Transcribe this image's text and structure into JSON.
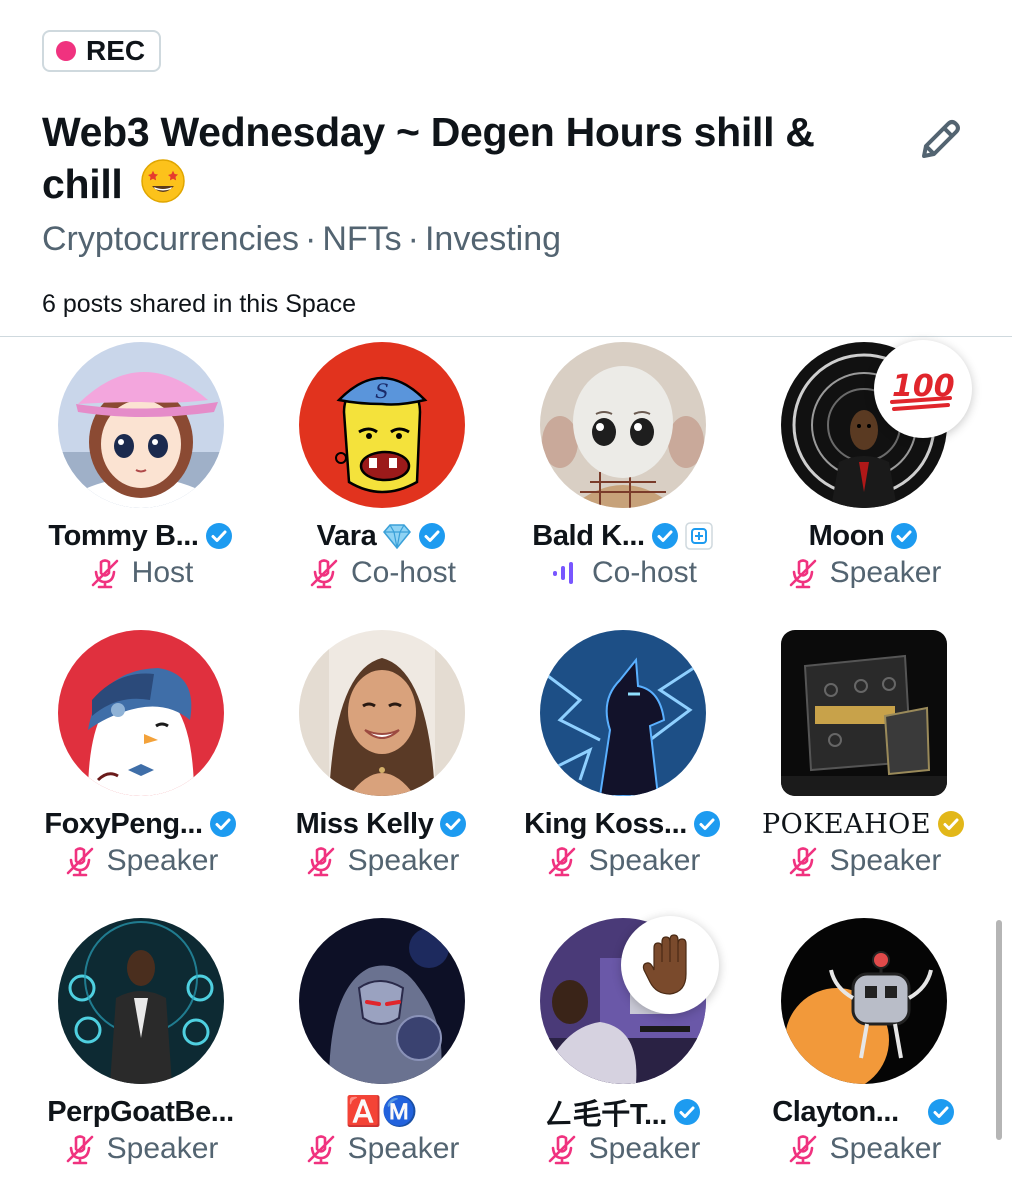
{
  "rec_badge": {
    "label": "REC",
    "color": "#f0327f"
  },
  "space": {
    "title": "Web3 Wednesday ~ Degen Hours shill & chill",
    "title_emoji": "star-struck",
    "topics": [
      "Cryptocurrencies",
      "NFTs",
      "Investing"
    ],
    "topic_separator": "·",
    "posts_shared": "6 posts shared in this Space"
  },
  "colors": {
    "accent": "#1d9bf0",
    "muted_mic": "#f0327f",
    "gold_badge": "#e2b719",
    "speaking": "#7856ff"
  },
  "participants": [
    {
      "name": "Tommy B...",
      "role": "Host",
      "verified": "blue",
      "mic": "muted",
      "avatar": "pink-cap-girl"
    },
    {
      "name": "Vara",
      "extra_emoji": "💎",
      "role": "Co-host",
      "verified": "blue",
      "mic": "muted",
      "avatar": "cartoon-red"
    },
    {
      "name": "Bald K...",
      "role": "Co-host",
      "verified": "blue",
      "affiliate_badge": true,
      "mic": "speaking",
      "avatar": "bald-figure"
    },
    {
      "name": "Moon",
      "role": "Speaker",
      "verified": "blue",
      "mic": "muted",
      "avatar": "dark-suit",
      "reaction": "100"
    },
    {
      "name": "FoxyPeng...",
      "role": "Speaker",
      "verified": "blue",
      "mic": "muted",
      "avatar": "penguin"
    },
    {
      "name": "Miss Kelly",
      "role": "Speaker",
      "verified": "blue",
      "mic": "muted",
      "avatar": "woman-photo"
    },
    {
      "name": "King Koss...",
      "role": "Speaker",
      "verified": "blue",
      "mic": "muted",
      "avatar": "lightning-horse"
    },
    {
      "name": "POKEAHOE",
      "role": "Speaker",
      "verified": "gold",
      "mic": "muted",
      "avatar": "pokeahoe-box"
    },
    {
      "name": "PerpGoatBe...",
      "role": "Speaker",
      "verified": "none",
      "mic": "muted",
      "avatar": "crypto-man"
    },
    {
      "name": "🅰️Ⓜ️",
      "role": "Speaker",
      "verified": "none",
      "mic": "muted",
      "avatar": "cosmic-robot"
    },
    {
      "name": "ㄥ毛千T...",
      "role": "Speaker",
      "verified": "blue",
      "mic": "muted",
      "avatar": "desk-photo",
      "reaction": "raised-hand"
    },
    {
      "name": "Clayton...",
      "role": "Speaker",
      "verified": "blue",
      "mic": "muted",
      "avatar": "robot-orange"
    }
  ]
}
